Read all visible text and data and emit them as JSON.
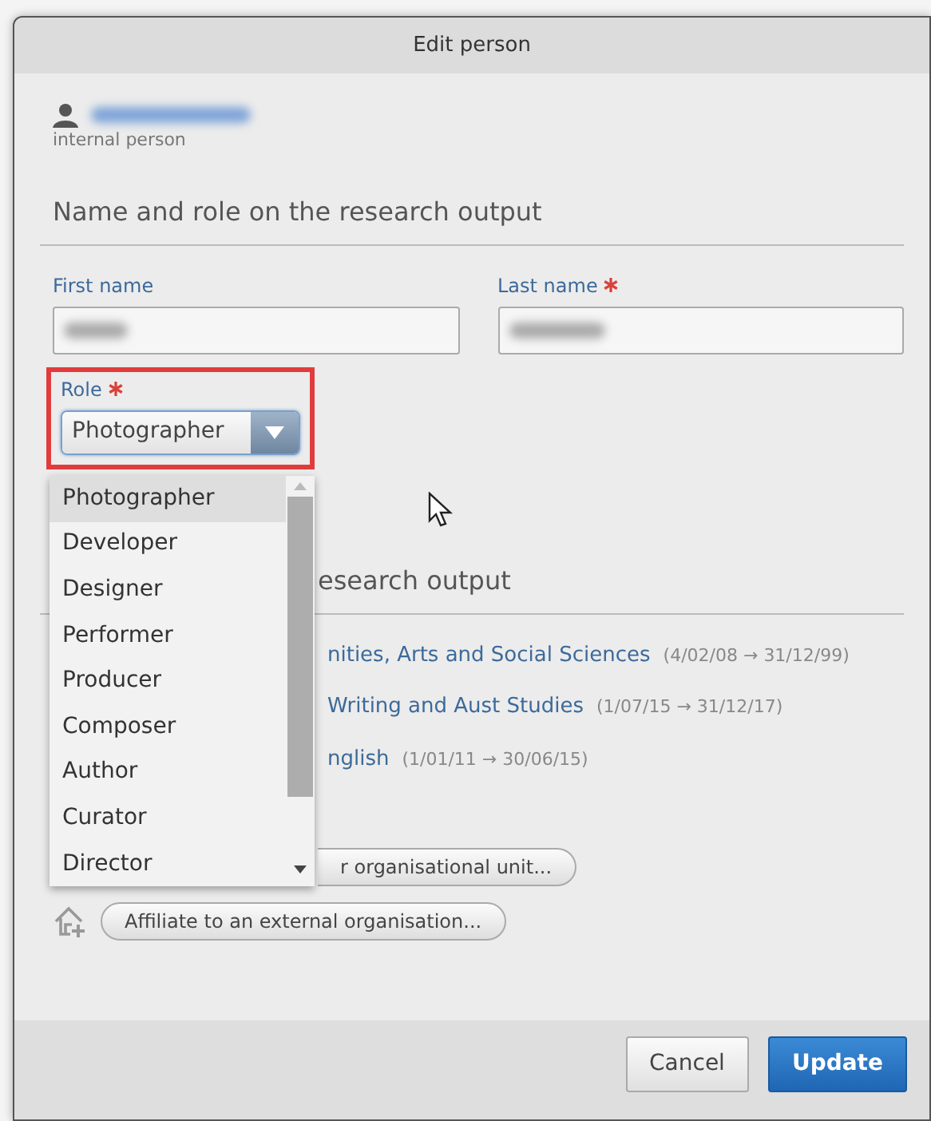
{
  "window": {
    "title": "Edit person"
  },
  "person": {
    "subtitle": "internal person"
  },
  "name_section": {
    "heading": "Name and role on the research output"
  },
  "fields": [
    {
      "label": "First name",
      "required": false
    },
    {
      "label": "Last name",
      "required": true
    }
  ],
  "role": {
    "label": "Role",
    "required": true,
    "value": "Photographer",
    "highlighted": true
  },
  "role_options": [
    {
      "label": "Photographer",
      "selected": true
    },
    {
      "label": "Developer",
      "selected": false
    },
    {
      "label": "Designer",
      "selected": false
    },
    {
      "label": "Performer",
      "selected": false
    },
    {
      "label": "Producer",
      "selected": false
    },
    {
      "label": "Composer",
      "selected": false
    },
    {
      "label": "Author",
      "selected": false
    },
    {
      "label": "Curator",
      "selected": false
    },
    {
      "label": "Director",
      "selected": false
    }
  ],
  "affiliation_section": {
    "heading": "esearch output"
  },
  "affiliations": [
    {
      "name": "nities, Arts and Social Sciences",
      "dates": "(4/02/08 → 31/12/99)"
    },
    {
      "name": "Writing and Aust Studies",
      "dates": "(1/07/15 → 31/12/17)"
    },
    {
      "name": "nglish",
      "dates": "(1/01/11 → 30/06/15)"
    }
  ],
  "affiliate_buttons": [
    {
      "label": "r organisational unit...",
      "kind": "partial"
    },
    {
      "label": "Affiliate to an external organisation...",
      "kind": "external"
    }
  ],
  "buttons": [
    {
      "label": "Cancel",
      "kind": "secondary"
    },
    {
      "label": "Update",
      "kind": "primary"
    }
  ]
}
